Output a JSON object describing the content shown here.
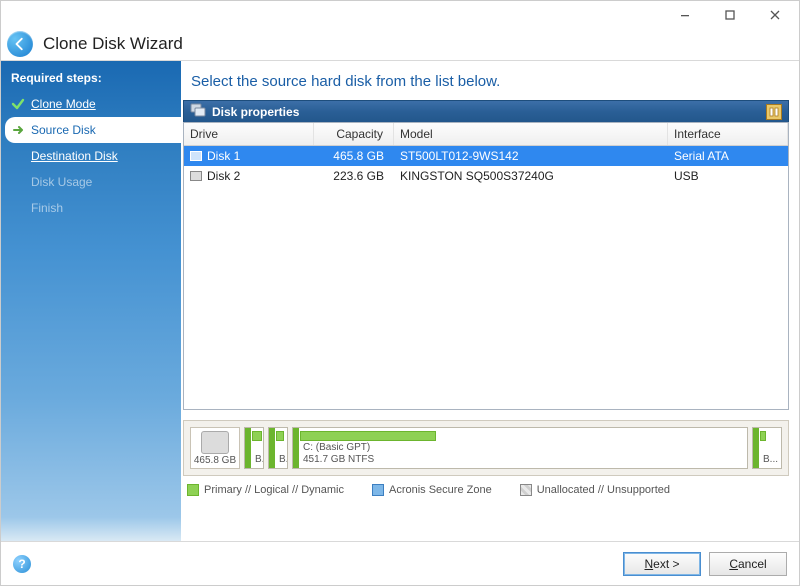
{
  "window": {
    "title": "Clone Disk Wizard"
  },
  "sidebar": {
    "heading": "Required steps:",
    "steps": [
      {
        "label": "Clone Mode",
        "state": "done"
      },
      {
        "label": "Source Disk",
        "state": "current"
      },
      {
        "label": "Destination Disk",
        "state": "future"
      },
      {
        "label": "Disk Usage",
        "state": "dim"
      },
      {
        "label": "Finish",
        "state": "dim"
      }
    ]
  },
  "main": {
    "heading": "Select the source hard disk from the list below.",
    "panel_title": "Disk properties",
    "columns": {
      "drive": "Drive",
      "capacity": "Capacity",
      "model": "Model",
      "interface": "Interface"
    },
    "disks": [
      {
        "drive": "Disk 1",
        "capacity": "465.8 GB",
        "model": "ST500LT012-9WS142",
        "interface": "Serial ATA",
        "selected": true
      },
      {
        "drive": "Disk 2",
        "capacity": "223.6 GB",
        "model": "KINGSTON SQ500S37240G",
        "interface": "USB",
        "selected": false
      }
    ],
    "layout": {
      "disk_capacity": "465.8 GB",
      "partitions": [
        {
          "label_top": "",
          "label_bottom": "B...",
          "width_pct": 3,
          "fill_pct": 70
        },
        {
          "label_top": "",
          "label_bottom": "B...",
          "width_pct": 3,
          "fill_pct": 55
        },
        {
          "label_top": "C: (Basic GPT)",
          "label_bottom": "451.7 GB  NTFS",
          "width_pct": 90,
          "fill_pct": 30
        },
        {
          "label_top": "",
          "label_bottom": "B...",
          "width_pct": 4,
          "fill_pct": 15
        }
      ]
    },
    "legend": {
      "primary": "Primary // Logical // Dynamic",
      "secure": "Acronis Secure Zone",
      "unalloc": "Unallocated // Unsupported"
    }
  },
  "footer": {
    "next": "Next >",
    "cancel": "Cancel",
    "next_uline": "N",
    "next_rest": "ext >",
    "cancel_uline": "C",
    "cancel_rest": "ancel"
  }
}
